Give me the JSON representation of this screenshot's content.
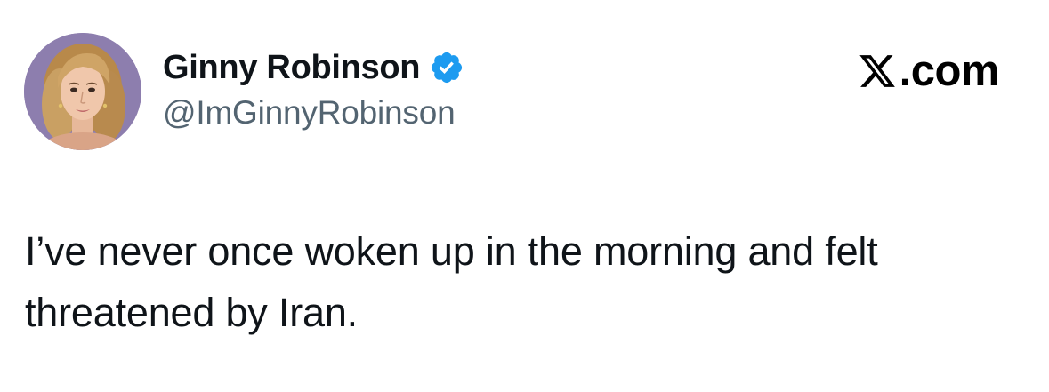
{
  "tweet": {
    "author": {
      "display_name": "Ginny Robinson",
      "handle": "@ImGinnyRobinson",
      "verified": true,
      "verified_badge_icon": "verified-badge-icon",
      "avatar_icon": "profile-photo"
    },
    "site": {
      "logo_icon": "x-logo-icon",
      "suffix": ".com"
    },
    "text_lines": [
      "I’ve never once woken up in the morning and felt",
      "threatened by Iran."
    ]
  },
  "colors": {
    "text_primary": "#0f1419",
    "text_secondary": "#536471",
    "verified_blue": "#1d9bf0",
    "background": "#ffffff"
  }
}
